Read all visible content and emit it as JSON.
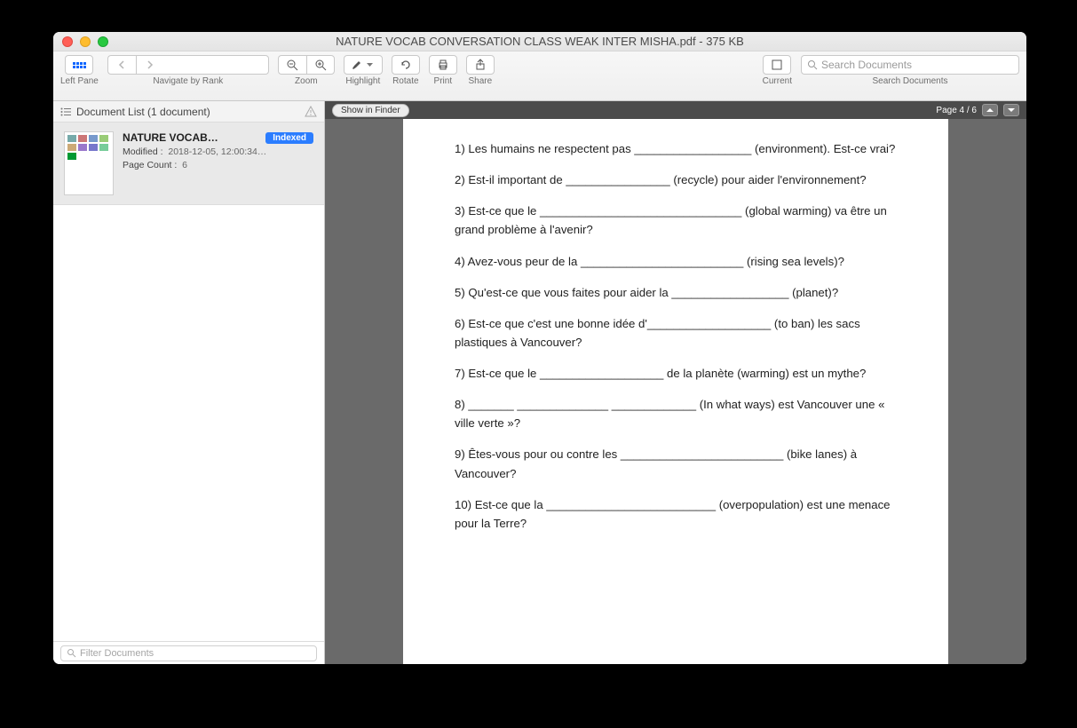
{
  "window": {
    "title": "NATURE VOCAB CONVERSATION CLASS WEAK INTER MISHA.pdf - 375 KB"
  },
  "toolbar": {
    "leftpane_label": "Left Pane",
    "navigate_label": "Navigate by Rank",
    "zoom_label": "Zoom",
    "highlight_label": "Highlight",
    "rotate_label": "Rotate",
    "print_label": "Print",
    "share_label": "Share",
    "current_label": "Current",
    "search_label": "Search Documents",
    "search_placeholder": "Search Documents"
  },
  "sidebar": {
    "header": "Document List (1 document)",
    "doc": {
      "title": "NATURE VOCAB…",
      "badge": "Indexed",
      "modified_label": "Modified :",
      "modified_value": "2018-12-05, 12:00:34…",
      "page_count_label": "Page Count :",
      "page_count_value": "6"
    },
    "filter_placeholder": "Filter Documents"
  },
  "viewer": {
    "show_in_finder": "Show in Finder",
    "page_indicator": "Page 4 / 6"
  },
  "document": {
    "lines": [
      "1) Les humains ne respectent pas __________________ (environment). Est-ce vrai?",
      "2) Est-il important de ________________ (recycle) pour aider l'environnement?",
      "3) Est-ce que le _______________________________ (global warming) va être un grand problème à l'avenir?",
      "4) Avez-vous peur de la _________________________ (rising sea levels)?",
      "5) Qu'est-ce que vous faites pour aider la __________________ (planet)?",
      "6) Est-ce que c'est une bonne idée d'___________________ (to ban) les sacs plastiques à Vancouver?",
      "7) Est-ce que le ___________________ de la planète (warming) est un mythe?",
      "8) _______ ______________ _____________ (In what ways) est Vancouver une « ville verte »?",
      "9) Êtes-vous pour ou contre les _________________________ (bike lanes) à Vancouver?",
      "10) Est-ce que la __________________________ (overpopulation) est une menace pour la Terre?"
    ]
  }
}
